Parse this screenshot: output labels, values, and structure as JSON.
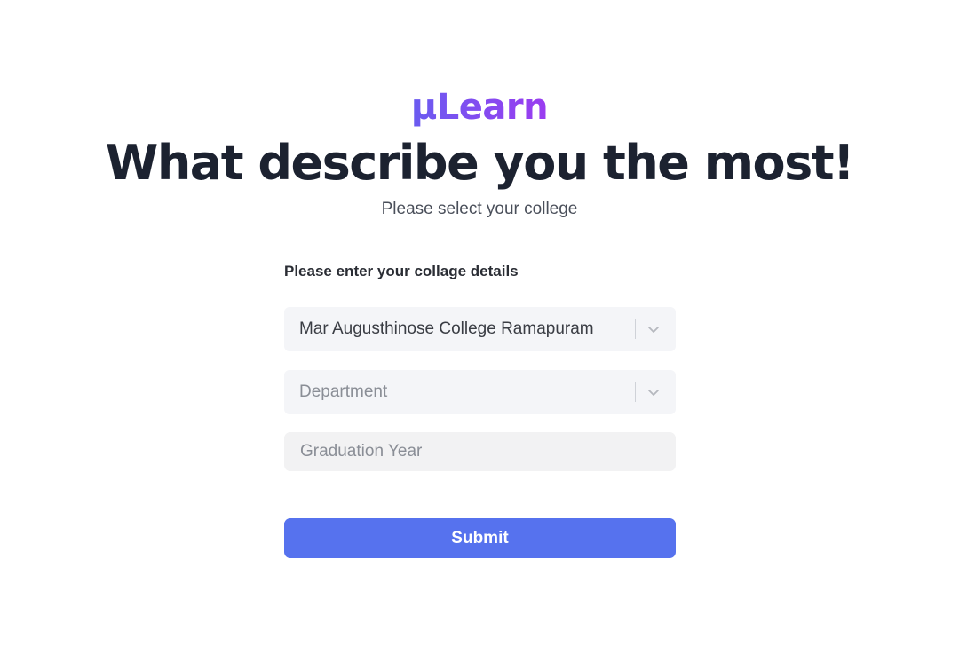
{
  "brand": {
    "logo_text": "μLearn",
    "gradient_start": "#6a5cf0",
    "gradient_end": "#9b3cf0"
  },
  "header": {
    "title": "What describe you the most!",
    "subtitle": "Please select your college"
  },
  "form": {
    "label": "Please enter your collage details",
    "college_select": {
      "value": "Mar Augusthinose College Ramapuram",
      "icon": "chevron-down-icon"
    },
    "department_select": {
      "placeholder": "Department",
      "icon": "chevron-down-icon"
    },
    "graduation_year": {
      "placeholder": "Graduation Year",
      "value": ""
    },
    "submit_label": "Submit"
  },
  "colors": {
    "primary": "#5672ee",
    "title": "#1c2230",
    "field_bg": "#f4f5f8"
  }
}
